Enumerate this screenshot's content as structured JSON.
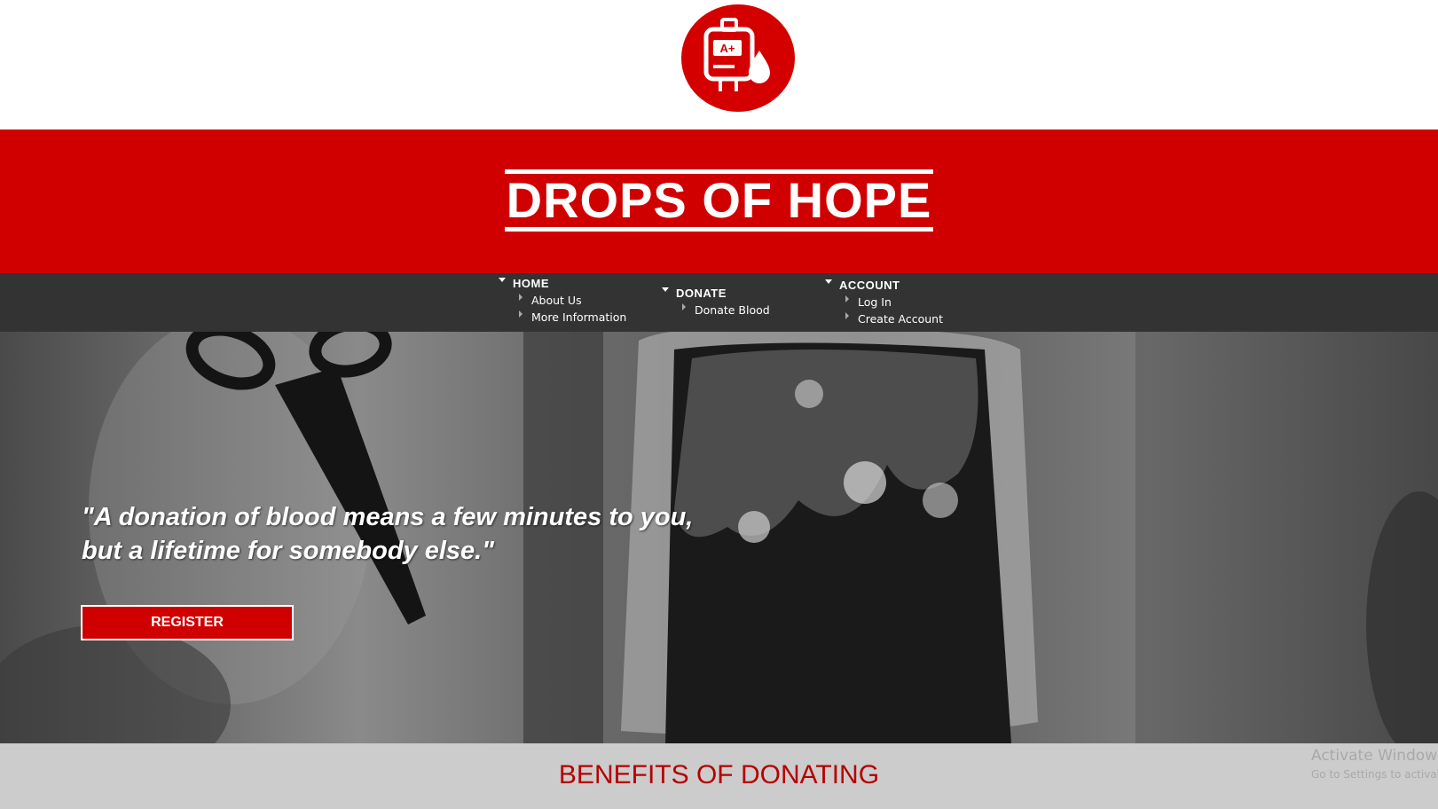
{
  "logo": {
    "icon": "blood-bag-icon",
    "label": "A+",
    "color": "#d40000"
  },
  "header": {
    "title": "DROPS OF HOPE",
    "band_color": "#d10000"
  },
  "nav": {
    "home": {
      "label": "HOME",
      "items": [
        "About Us",
        "More Information"
      ]
    },
    "donate": {
      "label": "DONATE",
      "items": [
        "Donate Blood"
      ]
    },
    "account": {
      "label": "ACCOUNT",
      "items": [
        "Log In",
        "Create Account"
      ]
    }
  },
  "hero": {
    "quote_line1": "\"A donation of blood means a few minutes to you,",
    "quote_line2": "but a lifetime for somebody else.\"",
    "register_label": "REGISTER"
  },
  "benefits": {
    "title": "BENEFITS OF DONATING"
  },
  "os_watermark": {
    "line1": "Activate Windows",
    "line2": "Go to Settings to activate Windows."
  }
}
